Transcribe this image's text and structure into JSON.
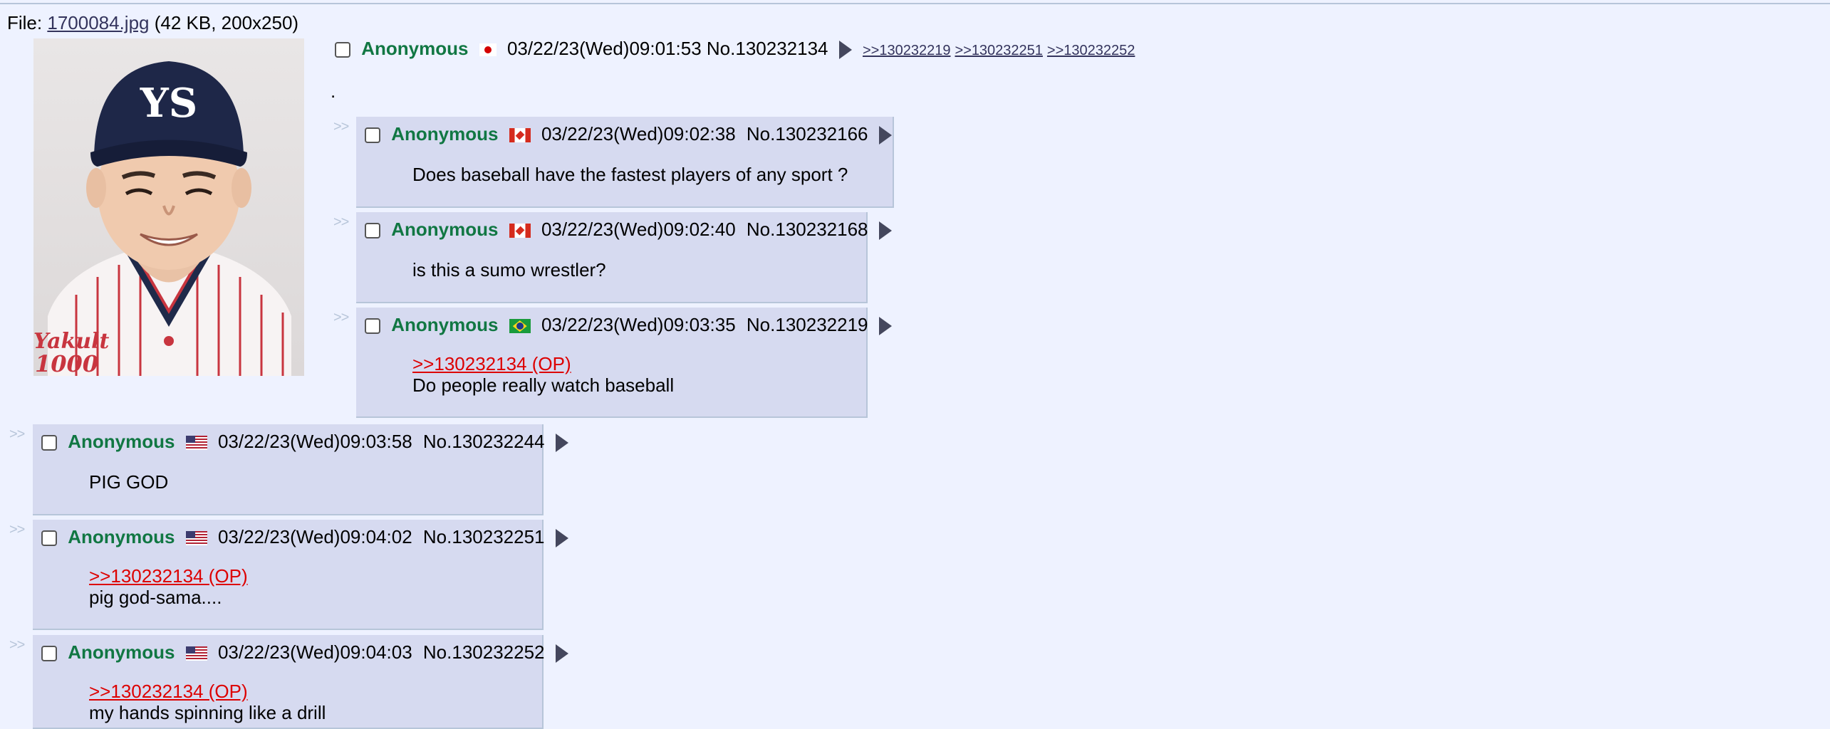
{
  "file": {
    "label": "File:",
    "filename": "1700084.jpg",
    "meta": "(42 KB, 200x250)"
  },
  "op": {
    "name": "Anonymous",
    "flag": "flag-japan",
    "datetime": "03/22/23(Wed)09:01:53",
    "number": "No.130232134",
    "backlinks": [
      ">>130232219",
      ">>130232251",
      ">>130232252"
    ],
    "message": ".",
    "image_logo_text": [
      "Yakult",
      "1000"
    ]
  },
  "side_arrows": ">>",
  "replies": [
    {
      "name": "Anonymous",
      "flag": "flag-canada",
      "datetime": "03/22/23(Wed)09:02:38",
      "number": "No.130232166",
      "quote": "",
      "message": "Does baseball have the fastest players of any sport ?"
    },
    {
      "name": "Anonymous",
      "flag": "flag-canada",
      "datetime": "03/22/23(Wed)09:02:40",
      "number": "No.130232168",
      "quote": "",
      "message": "is this a sumo wrestler?"
    },
    {
      "name": "Anonymous",
      "flag": "flag-brazil",
      "datetime": "03/22/23(Wed)09:03:35",
      "number": "No.130232219",
      "quote": ">>130232134 (OP)",
      "message": "Do people really watch baseball"
    },
    {
      "name": "Anonymous",
      "flag": "flag-usa",
      "datetime": "03/22/23(Wed)09:03:58",
      "number": "No.130232244",
      "quote": "",
      "message": "PIG GOD"
    },
    {
      "name": "Anonymous",
      "flag": "flag-usa",
      "datetime": "03/22/23(Wed)09:04:02",
      "number": "No.130232251",
      "quote": ">>130232134 (OP)",
      "message": "pig god-sama...."
    },
    {
      "name": "Anonymous",
      "flag": "flag-usa",
      "datetime": "03/22/23(Wed)09:04:03",
      "number": "No.130232252",
      "quote": ">>130232134 (OP)",
      "message": "my hands spinning like a drill"
    }
  ],
  "colors": {
    "background": "#eef2ff",
    "reply_bg": "#d6daf0",
    "name": "#117743",
    "quotelink": "#dd0000",
    "link": "#34345c"
  }
}
